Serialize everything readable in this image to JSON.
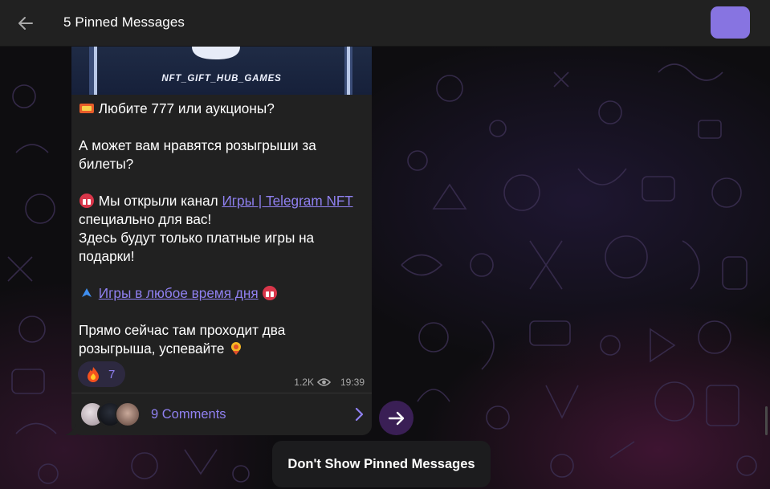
{
  "header": {
    "title": "5 Pinned Messages",
    "accent_color": "#8774e1"
  },
  "message": {
    "media_caption": "NFT_GIFT_HUB_GAMES",
    "paragraphs": {
      "p1": "Любите 777 или аукционы?",
      "p2": "А может вам нравятся розыгрыши за билеты?",
      "p3_before": "Мы открыли канал ",
      "p3_link": "Игры | Telegram NFT",
      "p3_after": " специально для вас!",
      "p4": "Здесь будут только платные игры на подарки!",
      "p5_link": "Игры в любое время дня",
      "p6": "Прямо сейчас там проходит два розыгрыша, успевайте"
    },
    "icons": {
      "p1": "ticket-icon",
      "p3": "gift-icon",
      "p5": "pointer-icon",
      "p5_end": "gift-icon",
      "p6": "medal-icon"
    },
    "reaction": {
      "icon": "fire-icon",
      "count": "7"
    },
    "views": "1.2K",
    "time": "19:39",
    "comments_label": "9 Comments"
  },
  "unpin_label": "Don't Show Pinned Messages",
  "colors": {
    "header_bg": "#212121",
    "bubble_bg": "#212121",
    "link": "#8f80f0",
    "background": "#0e0d10"
  }
}
